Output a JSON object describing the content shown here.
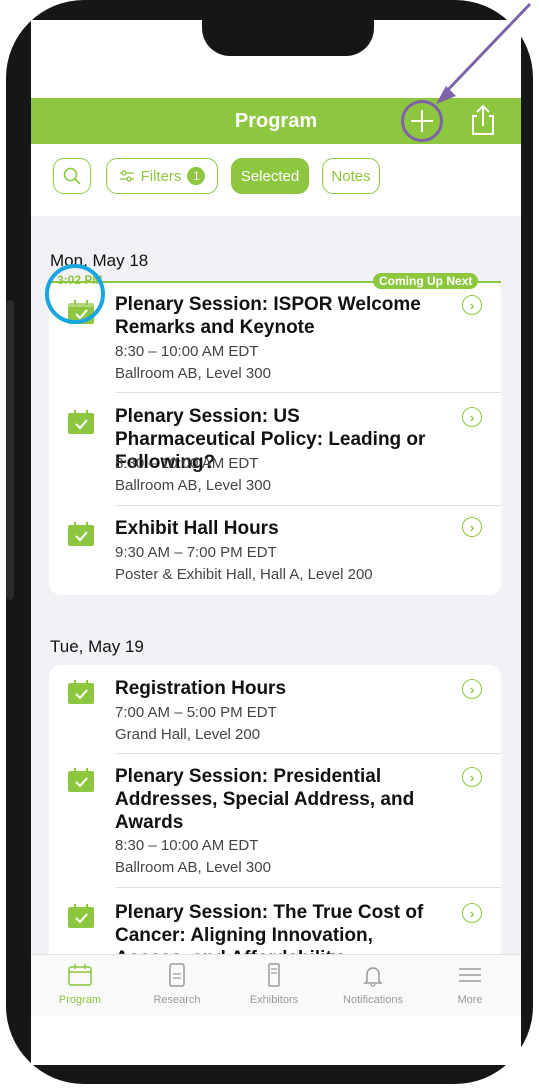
{
  "header": {
    "title": "Program"
  },
  "filters": {
    "search_icon": "search-icon",
    "filters_label": "Filters",
    "filters_count": "1",
    "selected_label": "Selected",
    "notes_label": "Notes"
  },
  "days": [
    {
      "label": "Mon, May 18",
      "now_time": "3:02 PM",
      "now_badge": "Coming Up Next",
      "items": [
        {
          "title": "Plenary Session: ISPOR Welcome Remarks and Keynote",
          "time": "8:30 – 10:00 AM EDT",
          "location": "Ballroom AB, Level 300"
        },
        {
          "title": "Plenary Session: US Pharmaceutical Policy: Leading or Following?",
          "time": "8:30 – 10:00 AM EDT",
          "location": "Ballroom AB, Level 300"
        },
        {
          "title": "Exhibit Hall Hours",
          "time": "9:30 AM – 7:00 PM EDT",
          "location": "Poster & Exhibit Hall, Hall A, Level 200"
        }
      ]
    },
    {
      "label": "Tue, May 19",
      "items": [
        {
          "title": "Registration Hours",
          "time": "7:00 AM – 5:00 PM EDT",
          "location": "Grand Hall, Level 200"
        },
        {
          "title": "Plenary Session: Presidential Addresses, Special Address, and Awards",
          "time": "8:30 – 10:00 AM EDT",
          "location": "Ballroom AB, Level 300"
        },
        {
          "title": "Plenary Session: The True Cost of Cancer: Aligning Innovation, Access, and Affordability"
        }
      ]
    }
  ],
  "tabs": [
    {
      "label": "Program",
      "icon": "calendar-icon"
    },
    {
      "label": "Research",
      "icon": "document-icon"
    },
    {
      "label": "Exhibitors",
      "icon": "booth-icon"
    },
    {
      "label": "Notifications",
      "icon": "bell-icon"
    },
    {
      "label": "More",
      "icon": "menu-icon"
    }
  ],
  "colors": {
    "accent": "#8dc63f",
    "annotation_purple": "#7f63a8",
    "annotation_blue": "#1aa5e0"
  }
}
